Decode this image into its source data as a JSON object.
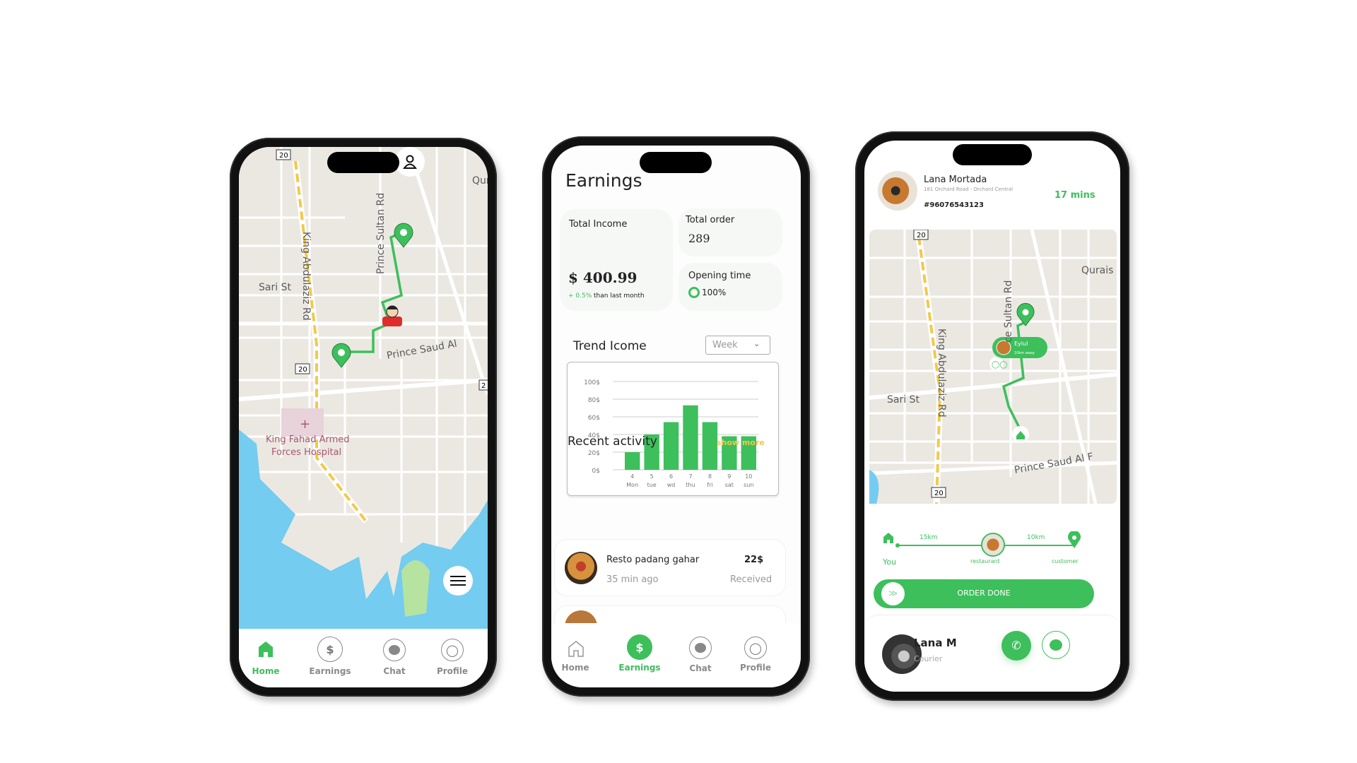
{
  "colors": {
    "accent": "#3dbf5c",
    "highlight": "#f2c94c",
    "map_bg": "#ebe8e2",
    "water": "#74ccf0"
  },
  "nav": {
    "items": [
      {
        "label": "Home",
        "icon": "home-icon"
      },
      {
        "label": "Earnings",
        "icon": "dollar-icon"
      },
      {
        "label": "Chat",
        "icon": "messenger-icon"
      },
      {
        "label": "Profile",
        "icon": "profile-icon"
      }
    ]
  },
  "map": {
    "road_labels": [
      "King Abdulaziz Rd",
      "Prince Sultan Rd",
      "Sari St",
      "Prince Saud Al",
      "Qura",
      "20",
      "20",
      "2"
    ],
    "poi": "King Fahad Armed",
    "poi2": "Forces Hospital"
  },
  "map3": {
    "road_labels": [
      "King Abdulaziz Rd",
      "ce Sultan Rd",
      "Sari St",
      "Prince Saud Al F",
      "Qurais",
      "20",
      "20"
    ],
    "courier_name": "Eylul",
    "courier_distance": "10km away"
  },
  "earnings": {
    "title": "Earnings",
    "total_income": {
      "label": "Total Income",
      "value": "$ 400.99",
      "change": "+ 0.5%",
      "change_suffix": "than last month"
    },
    "total_order": {
      "label": "Total order",
      "value": "289"
    },
    "opening_time": {
      "label": "Opening time",
      "value": "100%"
    },
    "trend": {
      "title": "Trend Icome",
      "period": "Week"
    },
    "recent": {
      "title": "Recent activity",
      "show_more": "show more",
      "items": [
        {
          "name": "Resto padang gahar",
          "time": "35 min ago",
          "amount": "22$",
          "status": "Received"
        }
      ]
    }
  },
  "chart_data": {
    "type": "bar",
    "categories": [
      "4 Mon",
      "5 tue",
      "6 wd",
      "7 thu",
      "8 fri",
      "9 sat",
      "10 sun"
    ],
    "days": [
      "4",
      "5",
      "6",
      "7",
      "8",
      "9",
      "10"
    ],
    "weekdays": [
      "Mon",
      "tue",
      "wd",
      "thu",
      "fri",
      "sat",
      "sun"
    ],
    "values": [
      20,
      40,
      54,
      73,
      54,
      38,
      38
    ],
    "yticks": [
      "0$",
      "20$",
      "40$",
      "60$",
      "80$",
      "100$"
    ],
    "ylim": [
      0,
      100
    ],
    "grid": true
  },
  "order": {
    "customer_name": "Lana Mortada",
    "address": "181 Orchard Road - Orchard Central",
    "order_id": "#96076543123",
    "eta": "17 mins",
    "progress": {
      "leg1": "15km",
      "leg2": "10km",
      "you": "You",
      "restaurant": "restaurant",
      "customer": "customer"
    },
    "done_label": "ORDER DONE",
    "courier": {
      "name": "Lana M",
      "role": "Courier"
    }
  }
}
